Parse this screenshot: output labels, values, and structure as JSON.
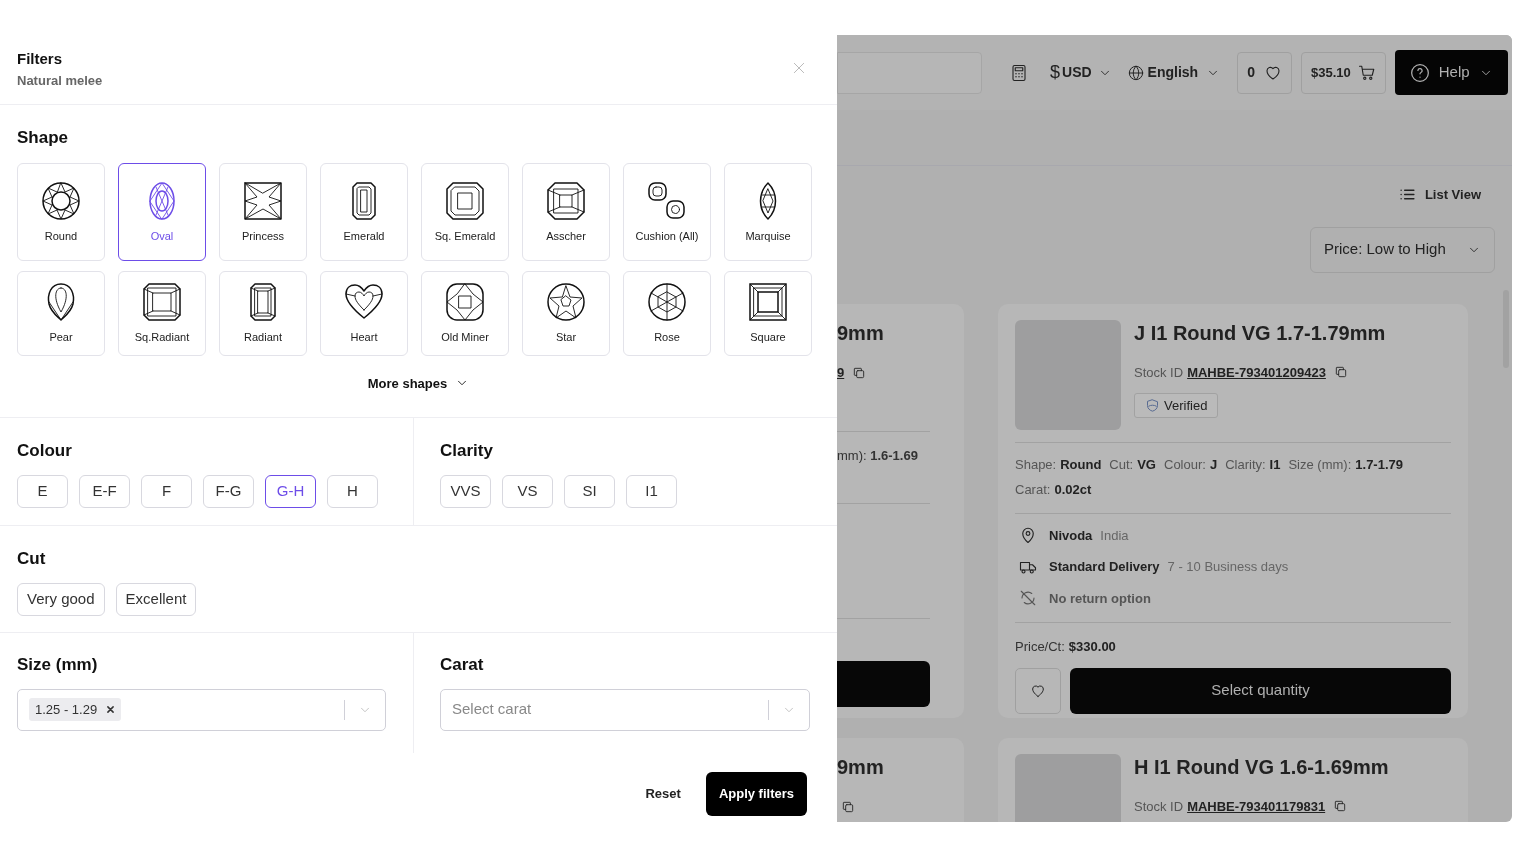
{
  "filters": {
    "title": "Filters",
    "subtitle": "Natural melee"
  },
  "shape": {
    "title": "Shape",
    "more": "More shapes",
    "items": [
      {
        "label": "Round",
        "kind": "round",
        "selected": false
      },
      {
        "label": "Oval",
        "kind": "oval",
        "selected": true
      },
      {
        "label": "Princess",
        "kind": "princess",
        "selected": false
      },
      {
        "label": "Emerald",
        "kind": "emerald",
        "selected": false
      },
      {
        "label": "Sq. Emerald",
        "kind": "sq-emerald",
        "selected": false
      },
      {
        "label": "Asscher",
        "kind": "asscher",
        "selected": false
      },
      {
        "label": "Cushion (All)",
        "kind": "cushion",
        "selected": false
      },
      {
        "label": "Marquise",
        "kind": "marquise",
        "selected": false
      },
      {
        "label": "Pear",
        "kind": "pear",
        "selected": false
      },
      {
        "label": "Sq.Radiant",
        "kind": "sq-radiant",
        "selected": false
      },
      {
        "label": "Radiant",
        "kind": "radiant",
        "selected": false
      },
      {
        "label": "Heart",
        "kind": "heart",
        "selected": false
      },
      {
        "label": "Old Miner",
        "kind": "old-miner",
        "selected": false
      },
      {
        "label": "Star",
        "kind": "star",
        "selected": false
      },
      {
        "label": "Rose",
        "kind": "rose",
        "selected": false
      },
      {
        "label": "Square",
        "kind": "square",
        "selected": false
      }
    ]
  },
  "colour": {
    "title": "Colour",
    "options": [
      {
        "label": "E",
        "selected": false
      },
      {
        "label": "E-F",
        "selected": false
      },
      {
        "label": "F",
        "selected": false
      },
      {
        "label": "F-G",
        "selected": false
      },
      {
        "label": "G-H",
        "selected": true
      },
      {
        "label": "H",
        "selected": false
      }
    ]
  },
  "clarity": {
    "title": "Clarity",
    "options": [
      {
        "label": "VVS",
        "selected": false
      },
      {
        "label": "VS",
        "selected": false
      },
      {
        "label": "SI",
        "selected": false
      },
      {
        "label": "I1",
        "selected": false
      }
    ]
  },
  "cut": {
    "title": "Cut",
    "options": [
      {
        "label": "Very good",
        "selected": false
      },
      {
        "label": "Excellent",
        "selected": false
      }
    ]
  },
  "size": {
    "title": "Size (mm)",
    "tags": [
      "1.25 - 1.29"
    ]
  },
  "carat": {
    "title": "Carat",
    "placeholder": "Select carat"
  },
  "actions": {
    "reset": "Reset",
    "apply": "Apply filters"
  },
  "background": {
    "header": {
      "currency_symbol": "$",
      "currency": "USD",
      "language": "English",
      "wishlist_count": "0",
      "cart_total": "$35.10",
      "help": "Help"
    },
    "view": "List View",
    "sort": "Price: Low to High",
    "rows": [
      {
        "partial": {
          "title": "9mm",
          "stock_id": "9",
          "spec": "mm): **1.6-1.69**"
        },
        "card": {
          "title": "J I1 Round VG 1.7-1.79mm",
          "stock_label": "Stock ID",
          "stock_id": "MAHBE-793401209423",
          "verified": "Verified",
          "specs": [
            {
              "label": "Shape:",
              "value": "Round"
            },
            {
              "label": "Cut:",
              "value": "VG"
            },
            {
              "label": "Colour:",
              "value": "J"
            },
            {
              "label": "Clarity:",
              "value": "I1"
            },
            {
              "label": "Size (mm):",
              "value": "1.7-1.79"
            },
            {
              "label": "Carat:",
              "value": "0.02ct"
            }
          ],
          "seller": "Nivoda",
          "country": "India",
          "delivery": "Standard Delivery",
          "delivery_time": "7 - 10 Business days",
          "returns": "No return option",
          "price_label": "Price/Ct:",
          "price": "$330.00",
          "button": "Select quantity"
        }
      },
      {
        "partial": {
          "title": "9mm"
        },
        "card": {
          "title": "H I1 Round VG 1.6-1.69mm",
          "stock_label": "Stock ID",
          "stock_id": "MAHBE-793401179831"
        }
      }
    ]
  }
}
